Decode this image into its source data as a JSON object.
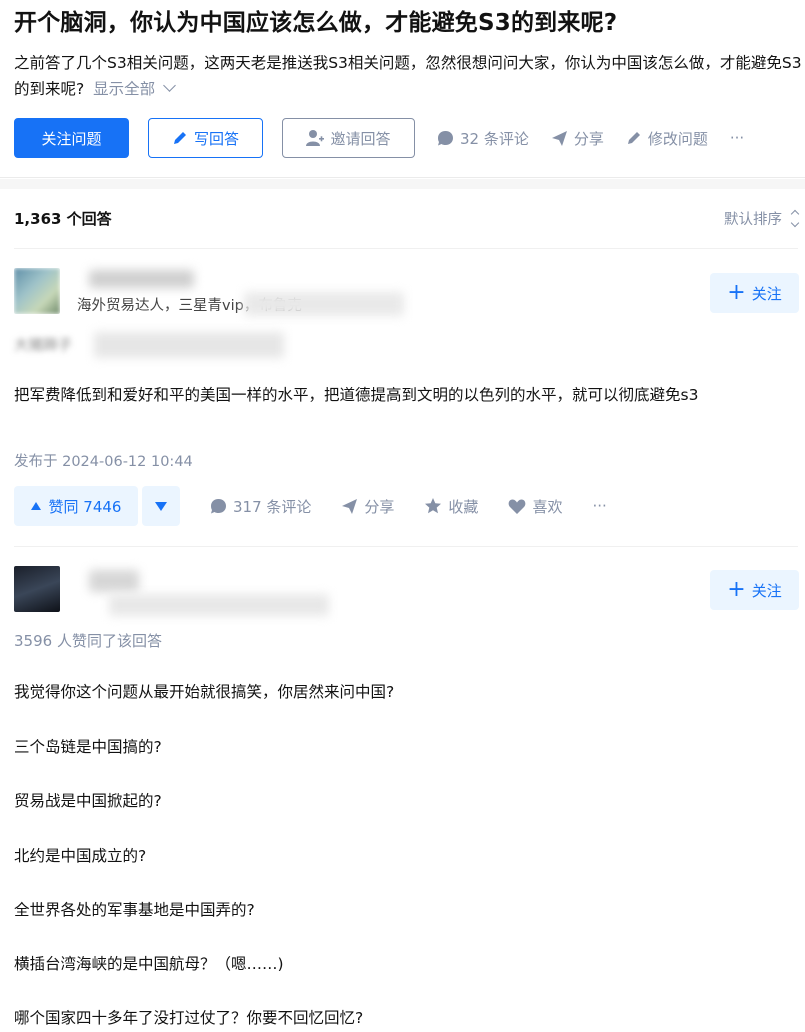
{
  "question": {
    "title": "开个脑洞，你认为中国应该怎么做，才能避免S3的到来呢?",
    "description": "之前答了几个S3相关问题，这两天老是推送我S3相关问题，忽然很想问问大家，你认为中国该怎么做，才能避免S3的到来呢?",
    "show_all": "显示全部"
  },
  "actions": {
    "follow_question": "关注问题",
    "write_answer": "写回答",
    "invite_answer": "邀请回答",
    "comments": "32 条评论",
    "share": "分享",
    "edit_question": "修改问题",
    "more": "···"
  },
  "answers_header": {
    "count": "1,363 个回答",
    "sort": "默认排序"
  },
  "answers": [
    {
      "author_bio": "海外贸易达人，三星青vip，布鲁克",
      "author_sub": "大猪蹄子",
      "follow": "关注",
      "content": "把军费降低到和爱好和平的美国一样的水平，把道德提高到文明的以色列的水平，就可以彻底避免s3",
      "published": "发布于 2024-06-12 10:44",
      "vote_label": "赞同 7446",
      "comments": "317 条评论",
      "share": "分享",
      "collect": "收藏",
      "like": "喜欢",
      "more": "···"
    },
    {
      "follow": "关注",
      "likers": "3596 人赞同了该回答",
      "paragraphs": [
        "我觉得你这个问题从最开始就很搞笑，你居然来问中国?",
        "三个岛链是中国搞的?",
        "贸易战是中国掀起的?",
        "北约是中国成立的?",
        "全世界各处的军事基地是中国弄的?",
        "横插台湾海峡的是中国航母？（嗯……)",
        "哪个国家四十多年了没打过仗了？你要不回忆回忆?"
      ]
    }
  ],
  "colors": {
    "brand_blue": "#1772f6",
    "muted_gray": "#8590a6",
    "light_blue_bg": "#ebf5ff"
  }
}
